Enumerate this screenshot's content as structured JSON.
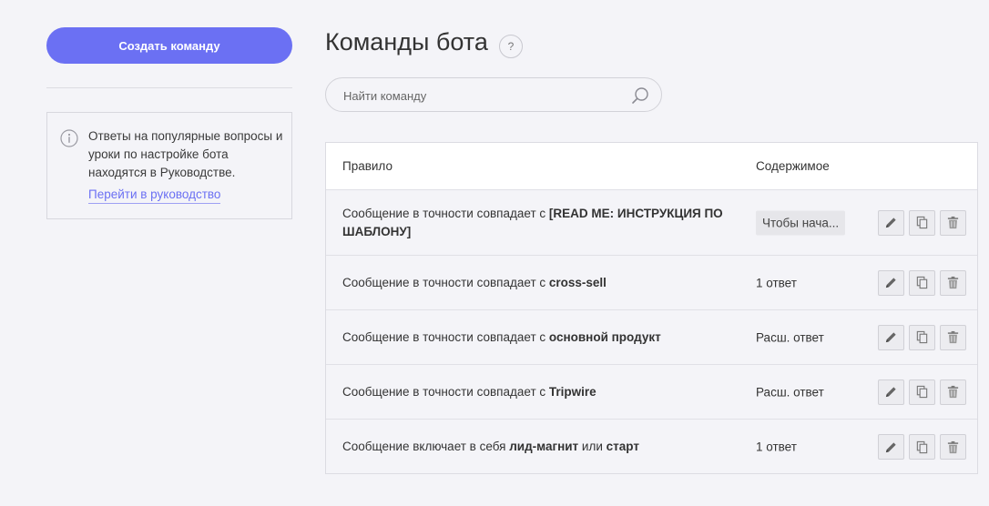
{
  "sidebar": {
    "create_button": "Создать команду",
    "help_text": "Ответы на популярные вопросы и уроки по настройке бота находятся в Руководстве.",
    "help_link": "Перейти в руководство"
  },
  "main": {
    "title": "Команды бота",
    "title_help": "?",
    "search_placeholder": "Найти команду"
  },
  "table": {
    "headers": {
      "rule": "Правило",
      "content": "Содержимое"
    },
    "rows": [
      {
        "prefix": "Сообщение в точности совпадает с ",
        "keyword": "[READ ME: ИНСТРУКЦИЯ ПО ШАБЛОНУ]",
        "mid": "",
        "keyword2": "",
        "content": "Чтобы нача..."
      },
      {
        "prefix": "Сообщение в точности совпадает с ",
        "keyword": "cross-sell",
        "mid": "",
        "keyword2": "",
        "content": "1 ответ"
      },
      {
        "prefix": "Сообщение в точности совпадает с ",
        "keyword": "основной продукт",
        "mid": "",
        "keyword2": "",
        "content": "Расш. ответ"
      },
      {
        "prefix": "Сообщение в точности совпадает с ",
        "keyword": "Tripwire",
        "mid": "",
        "keyword2": "",
        "content": "Расш. ответ"
      },
      {
        "prefix": "Сообщение включает в себя ",
        "keyword": "лид-магнит",
        "mid": " или ",
        "keyword2": "старт",
        "content": "1 ответ"
      }
    ]
  },
  "colors": {
    "accent": "#6b70f3",
    "background": "#f4f4f8"
  },
  "icons": {
    "info": "info-icon",
    "search": "search-icon",
    "edit": "pencil-icon",
    "copy": "copy-icon",
    "delete": "trash-icon"
  }
}
